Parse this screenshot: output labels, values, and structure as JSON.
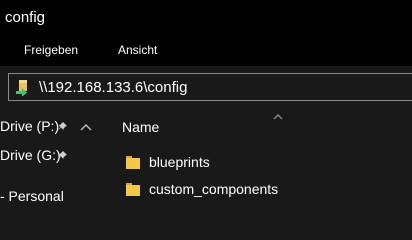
{
  "window": {
    "title": "config"
  },
  "ribbon": {
    "tabs": [
      {
        "label": "Freigeben"
      },
      {
        "label": "Ansicht"
      }
    ]
  },
  "address": {
    "path": "\\\\192.168.133.6\\config"
  },
  "navigation": {
    "items": [
      {
        "label": "Drive (P:)",
        "pinned": true
      },
      {
        "label": "Drive (G:)",
        "pinned": true
      },
      {
        "label": "- Personal"
      }
    ]
  },
  "content": {
    "column_header": "Name",
    "files": [
      {
        "name": "blueprints",
        "icon": "folder-icon"
      },
      {
        "name": "custom_components",
        "icon": "folder-icon"
      }
    ]
  },
  "colors": {
    "background": "#191919",
    "bar": "#000000",
    "folder": "#f2c84b"
  }
}
